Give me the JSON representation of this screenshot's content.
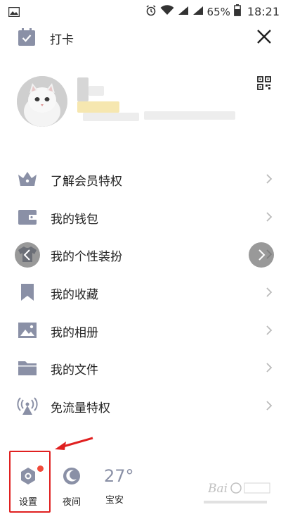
{
  "status_bar": {
    "battery_percent": "65%",
    "time": "18:21"
  },
  "header": {
    "checkin_label": "打卡"
  },
  "menu": [
    {
      "label": "了解会员特权",
      "icon": "crown-icon"
    },
    {
      "label": "我的钱包",
      "icon": "wallet-icon"
    },
    {
      "label": "我的个性装扮",
      "icon": "tshirt-icon"
    },
    {
      "label": "我的收藏",
      "icon": "bookmark-icon"
    },
    {
      "label": "我的相册",
      "icon": "photo-icon"
    },
    {
      "label": "我的文件",
      "icon": "folder-icon"
    },
    {
      "label": "免流量特权",
      "icon": "signal-tower-icon"
    }
  ],
  "bottom": {
    "settings_label": "设置",
    "night_label": "夜间",
    "temperature": "27°",
    "location": "宝安"
  },
  "colors": {
    "icon": "#8a90a6",
    "highlight": "#e02020",
    "badge": "#f04a3a"
  }
}
